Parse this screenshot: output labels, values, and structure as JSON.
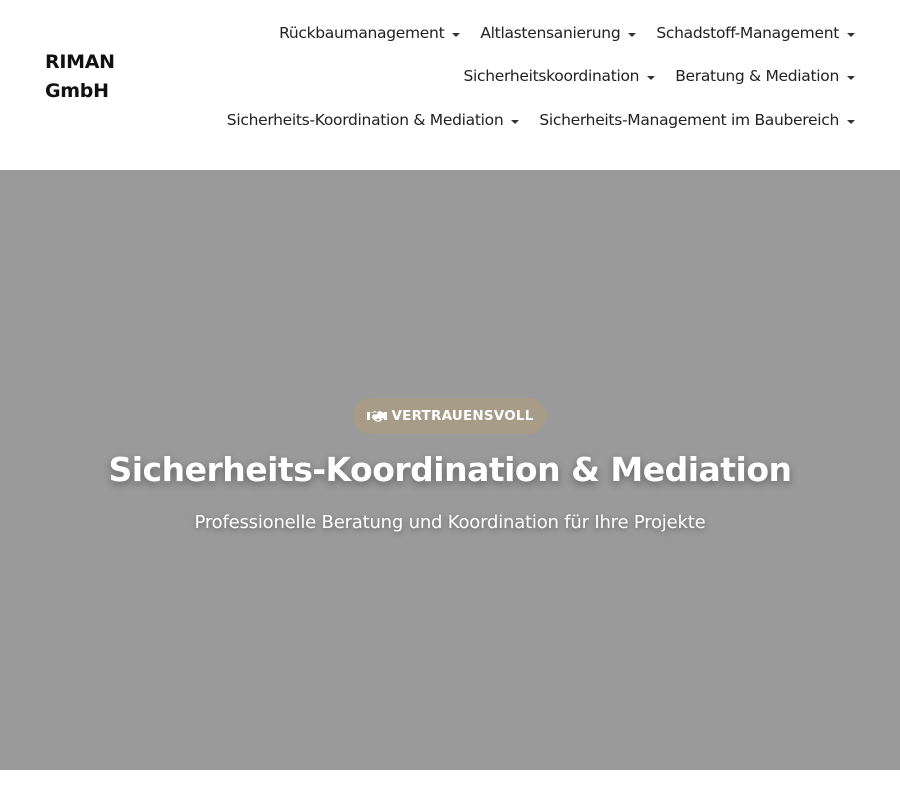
{
  "brand": {
    "line1": "RIMAN",
    "line2": "GmbH"
  },
  "nav": {
    "row1": [
      {
        "label": "Rückbaumanagement"
      },
      {
        "label": "Altlastensanierung"
      },
      {
        "label": "Schadstoff-Management"
      }
    ],
    "row2": [
      {
        "label": "Sicherheitskoordination"
      },
      {
        "label": "Beratung & Mediation"
      }
    ],
    "row3": [
      {
        "label": "Sicherheits-Koordination & Mediation"
      },
      {
        "label": "Sicherheits-Management im Baubereich"
      }
    ]
  },
  "hero": {
    "badge_icon": "handshake-icon",
    "badge_label": "VERTRAUENSVOLL",
    "title": "Sicherheits-Koordination & Mediation",
    "subtitle": "Professionelle Beratung und Koordination für Ihre Projekte",
    "background_color": "#9a9a9a",
    "badge_color": "#a69c87"
  }
}
